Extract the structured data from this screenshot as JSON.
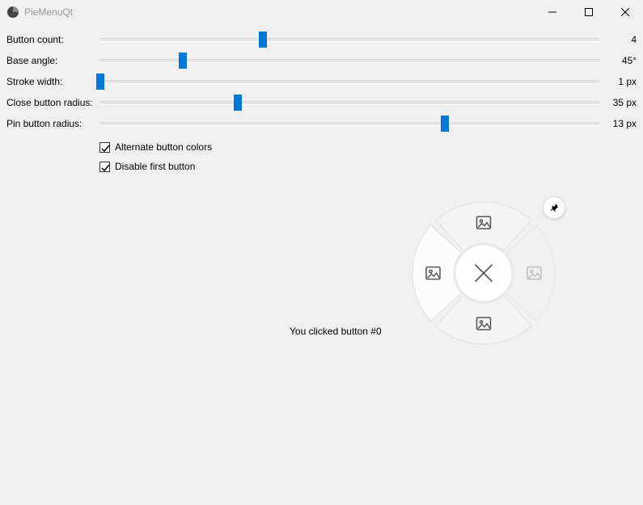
{
  "title": "PieMenuQt",
  "sliders": {
    "buttonCount": {
      "label": "Button count:",
      "value": "4",
      "pos": 32.5
    },
    "baseAngle": {
      "label": "Base angle:",
      "value": "45°",
      "pos": 16.5
    },
    "strokeWidth": {
      "label": "Stroke width:",
      "value": "1 px",
      "pos": 0
    },
    "closeRadius": {
      "label": "Close button radius:",
      "value": "35 px",
      "pos": 27.5
    },
    "pinRadius": {
      "label": "Pin button radius:",
      "value": "13 px",
      "pos": 69
    }
  },
  "checks": {
    "alternate": {
      "label": "Alternate button colors",
      "checked": true
    },
    "disableFirst": {
      "label": "Disable first button",
      "checked": true
    }
  },
  "status": "You clicked button #0",
  "pie": {
    "segments": 4
  }
}
